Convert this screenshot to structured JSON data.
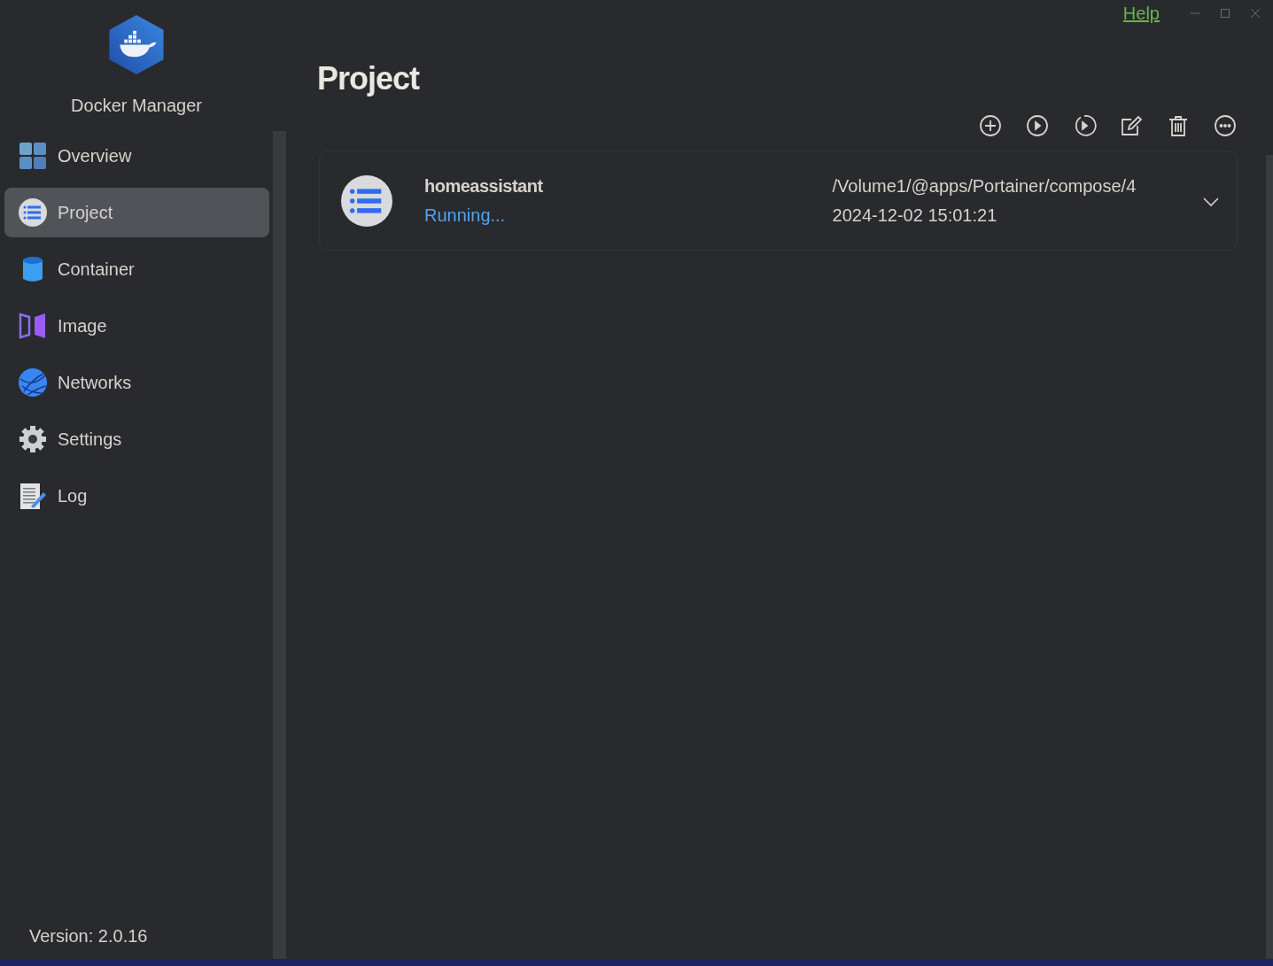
{
  "app": {
    "name": "Docker Manager",
    "version": "Version: 2.0.16"
  },
  "titlebar": {
    "help": "Help"
  },
  "sidebar": {
    "items": [
      {
        "label": "Overview",
        "selected": false
      },
      {
        "label": "Project",
        "selected": true
      },
      {
        "label": "Container",
        "selected": false
      },
      {
        "label": "Image",
        "selected": false
      },
      {
        "label": "Networks",
        "selected": false
      },
      {
        "label": "Settings",
        "selected": false
      },
      {
        "label": "Log",
        "selected": false
      }
    ]
  },
  "page": {
    "title": "Project"
  },
  "projects": [
    {
      "name": "homeassistant",
      "status": "Running...",
      "path": "/Volume1/@apps/Portainer/compose/4",
      "created": "2024-12-02 15:01:21",
      "expanded": false
    }
  ]
}
